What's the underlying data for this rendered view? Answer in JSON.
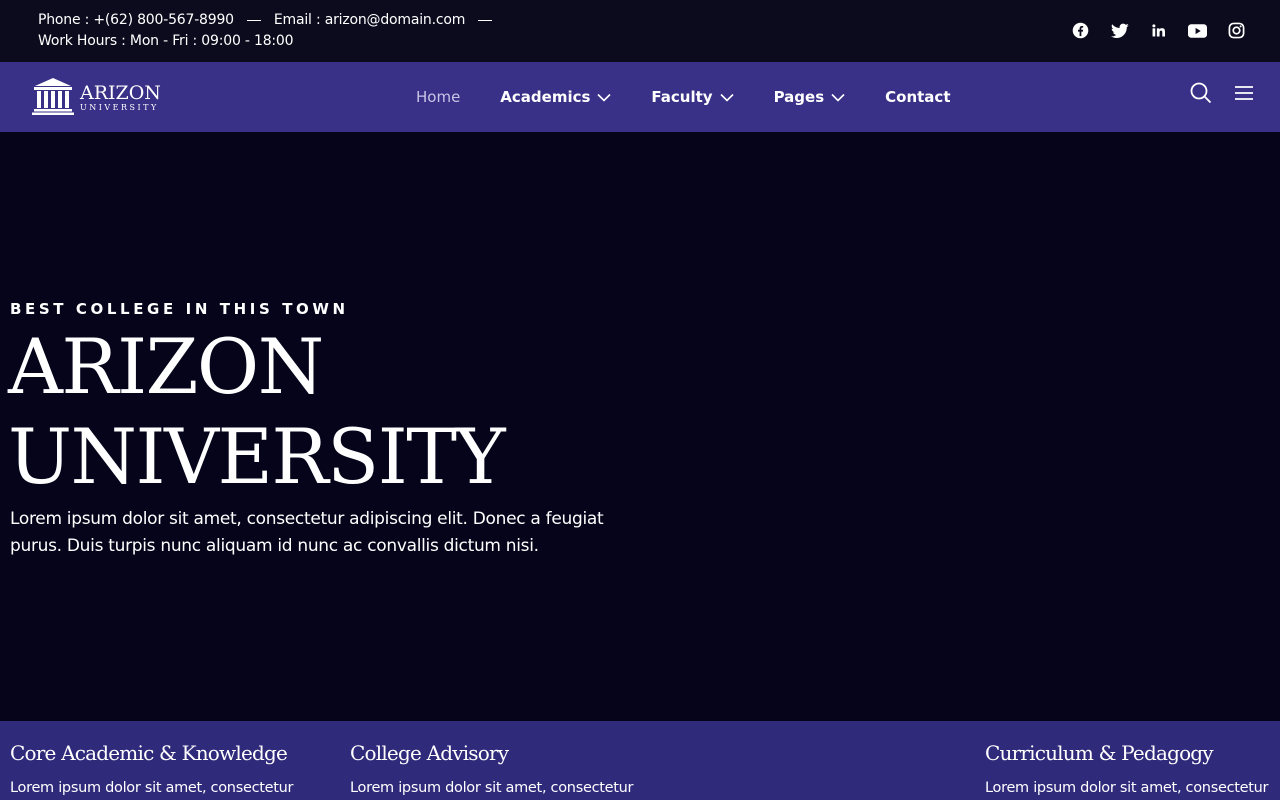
{
  "topbar": {
    "phone": "Phone : +(62) 800-567-8990",
    "email": "Email : arizon@domain.com",
    "hours": "Work Hours : Mon - Fri : 09:00 - 18:00",
    "social_icons": [
      "facebook-icon",
      "twitter-icon",
      "linkedin-icon",
      "youtube-icon",
      "instagram-icon"
    ]
  },
  "nav": {
    "logo_name": "ARIZON",
    "logo_sub": "UNIVERSITY",
    "items": [
      {
        "label": "Home",
        "dropdown": false
      },
      {
        "label": "Academics",
        "dropdown": true
      },
      {
        "label": "Faculty",
        "dropdown": true
      },
      {
        "label": "Pages",
        "dropdown": true
      },
      {
        "label": "Contact",
        "dropdown": false
      }
    ],
    "icons": [
      "search-icon",
      "hamburger-menu-icon"
    ]
  },
  "hero": {
    "kicker": "BEST COLLEGE IN THIS TOWN",
    "title_line1": "ARIZON",
    "title_line2": "UNIVERSITY",
    "description": "Lorem ipsum dolor sit amet, consectetur adipiscing elit. Donec a feugiat purus. Duis turpis nunc aliquam id nunc ac convallis dictum nisi."
  },
  "features": [
    {
      "title": "Core Academic & Knowledge",
      "text": "Lorem ipsum dolor sit amet, consectetur"
    },
    {
      "title": "College Advisory",
      "text": "Lorem ipsum dolor sit amet, consectetur"
    },
    {
      "title": "Curriculum & Pedagogy",
      "text": "Lorem ipsum dolor sit amet, consectetur"
    }
  ],
  "colors": {
    "topbar_bg": "#0c0b1e",
    "nav_bg": "#393087",
    "hero_bg": "#05041a",
    "features_bg": "#302a7b"
  }
}
